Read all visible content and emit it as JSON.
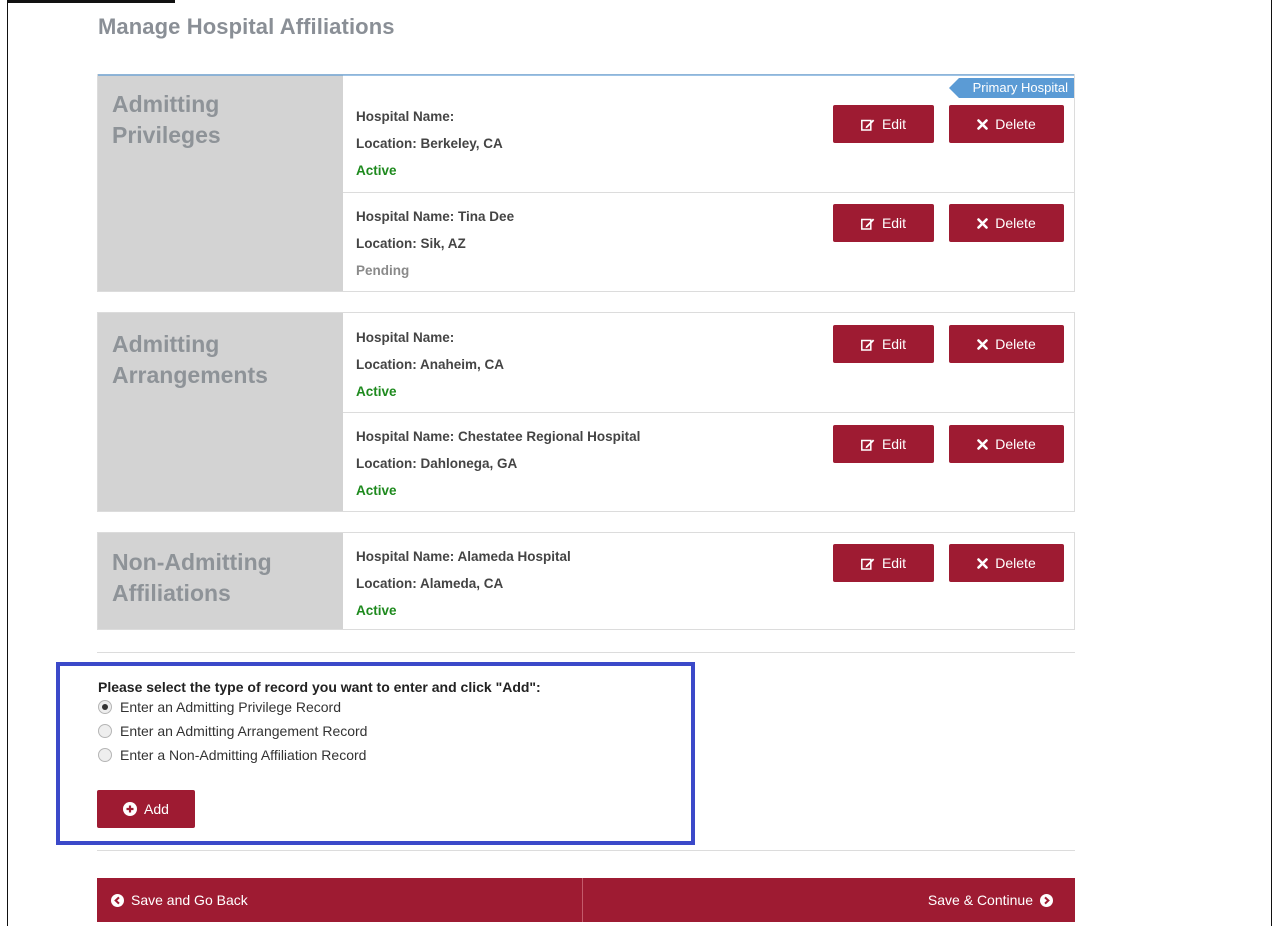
{
  "page": {
    "title": "Manage Hospital Affiliations"
  },
  "colors": {
    "brand": "#9e1b32",
    "active": "#1e8a1e",
    "pending": "#8a8a8a",
    "primary_tag": "#5b9bd5",
    "highlight_box": "#3b49c9"
  },
  "labels": {
    "edit": "Edit",
    "delete": "Delete",
    "hospital_name": "Hospital Name:",
    "location": "Location:"
  },
  "sections": [
    {
      "label_line1": "Admitting",
      "label_line2": "Privileges",
      "records": [
        {
          "hospital_name": "",
          "location": "Berkeley, CA",
          "status": "Active",
          "tag": "Primary Hospital"
        },
        {
          "hospital_name": "Tina Dee",
          "location": "Sik, AZ",
          "status": "Pending"
        }
      ]
    },
    {
      "label_line1": "Admitting",
      "label_line2": "Arrangements",
      "records": [
        {
          "hospital_name": "",
          "location": "Anaheim, CA",
          "status": "Active"
        },
        {
          "hospital_name": "Chestatee Regional Hospital",
          "location": "Dahlonega, GA",
          "status": "Active"
        }
      ]
    },
    {
      "label_line1": "Non-Admitting",
      "label_line2": "Affiliations",
      "records": [
        {
          "hospital_name": "Alameda Hospital",
          "location": "Alameda, CA",
          "status": "Active"
        }
      ]
    }
  ],
  "add_form": {
    "prompt": "Please select the type of record you want to enter and click \"Add\":",
    "options": [
      {
        "label": "Enter an Admitting Privilege Record",
        "selected": true
      },
      {
        "label": "Enter an Admitting Arrangement Record",
        "selected": false
      },
      {
        "label": "Enter a Non-Admitting Affiliation Record",
        "selected": false
      }
    ],
    "add_label": "Add"
  },
  "footer": {
    "back_label": "Save and Go Back",
    "continue_label": "Save & Continue"
  }
}
